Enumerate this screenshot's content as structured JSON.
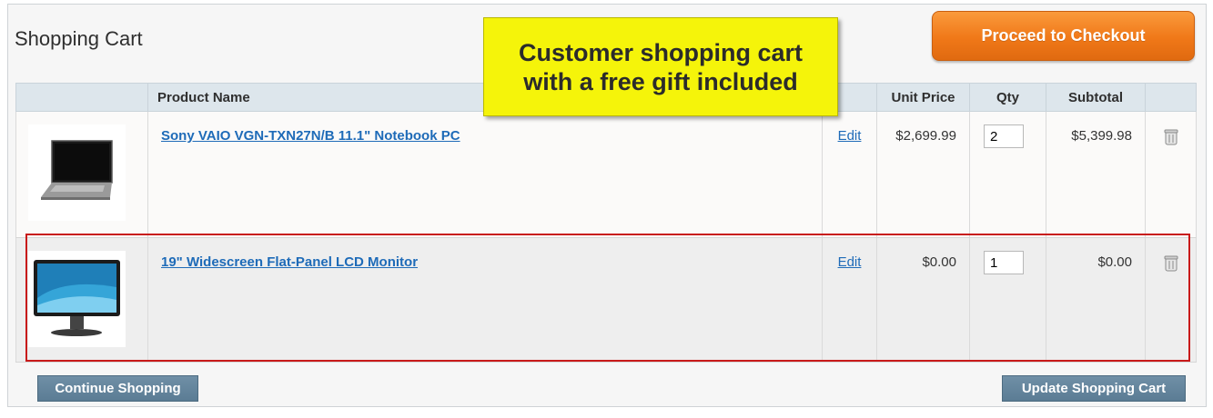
{
  "page": {
    "title": "Shopping Cart",
    "checkout_label": "Proceed to Checkout"
  },
  "table": {
    "headers": {
      "image": "",
      "product_name": "Product Name",
      "edit": "",
      "unit_price": "Unit Price",
      "qty": "Qty",
      "subtotal": "Subtotal",
      "remove": ""
    }
  },
  "items": [
    {
      "image_icon": "laptop-icon",
      "name": "Sony VAIO VGN-TXN27N/B 11.1\" Notebook PC",
      "edit_label": "Edit",
      "unit_price": "$2,699.99",
      "qty": "2",
      "subtotal": "$5,399.98",
      "remove_icon": "trash-icon"
    },
    {
      "image_icon": "monitor-icon",
      "name": "19\" Widescreen Flat-Panel LCD Monitor",
      "edit_label": "Edit",
      "unit_price": "$0.00",
      "qty": "1",
      "subtotal": "$0.00",
      "remove_icon": "trash-icon"
    }
  ],
  "actions": {
    "continue_label": "Continue Shopping",
    "update_label": "Update Shopping Cart"
  },
  "callout": {
    "line1": "Customer shopping cart",
    "line2": "with a free gift included"
  },
  "colors": {
    "checkout_orange": "#f07818",
    "action_gray_blue": "#5b7c94",
    "link_blue": "#1e6bb8",
    "highlight_red": "#c81a1a",
    "callout_yellow": "#f5f40a"
  }
}
